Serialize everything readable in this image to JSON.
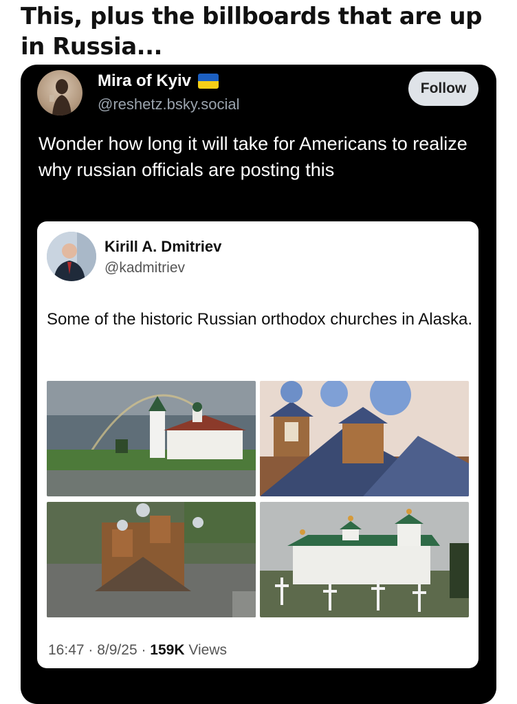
{
  "caption": "This, plus the billboards that are up in Russia...",
  "post": {
    "author_name": "Mira of Kyiv",
    "author_handle": "@reshetz.bsky.social",
    "follow_label": "Follow",
    "text": "Wonder how long it will take for Americans to realize why russian officials are posting this",
    "flag_colors": [
      "#1c5fc1",
      "#f5cf17"
    ]
  },
  "quoted": {
    "author_name": "Kirill A. Dmitriev",
    "author_handle": "@kadmitriev",
    "text": "Some of the historic Russian orthodox churches in Alaska.",
    "time": "16:47",
    "date": "8/9/25",
    "views_count": "159K",
    "views_label": "Views"
  }
}
